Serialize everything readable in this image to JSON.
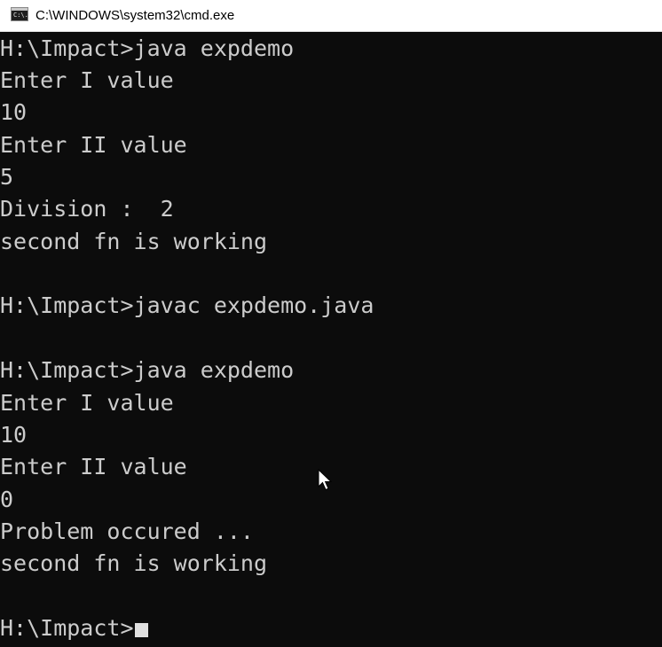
{
  "window": {
    "title": "C:\\WINDOWS\\system32\\cmd.exe",
    "icon": "cmd-icon",
    "icon_text": "C:\\."
  },
  "console": {
    "lines": [
      "H:\\Impact>java expdemo",
      "Enter I value",
      "10",
      "Enter II value",
      "5",
      "Division :  2",
      "second fn is working",
      "",
      "H:\\Impact>javac expdemo.java",
      "",
      "H:\\Impact>java expdemo",
      "Enter I value",
      "10",
      "Enter II value",
      "0",
      "Problem occured ...",
      "second fn is working",
      "",
      "H:\\Impact>"
    ]
  },
  "colors": {
    "background": "#0c0c0c",
    "text": "#cccccc",
    "cursor": "#e0e0e0"
  }
}
